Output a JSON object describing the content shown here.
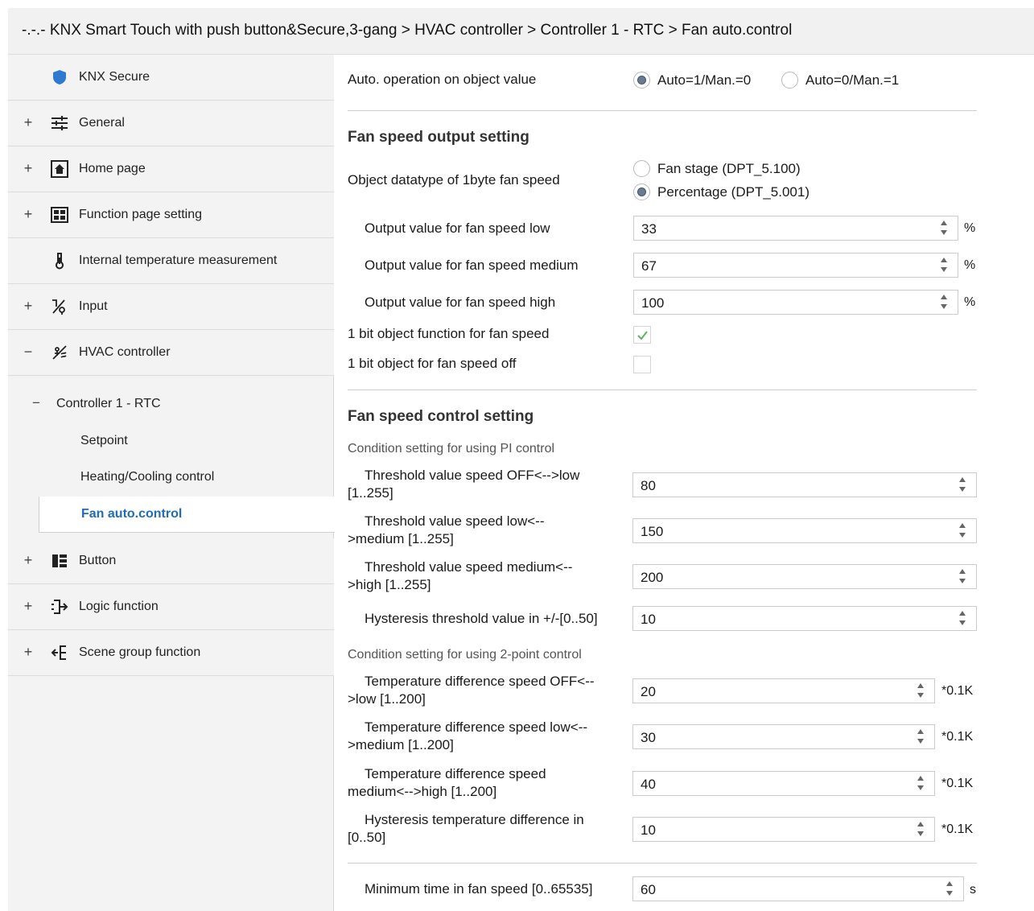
{
  "title": "-.-.- KNX Smart Touch with push button&Secure,3-gang > HVAC controller > Controller 1 - RTC > Fan auto.control",
  "sidebar": {
    "items": [
      {
        "label": "KNX Secure",
        "expander": "",
        "icon": "shield-icon"
      },
      {
        "label": "General",
        "expander": "+",
        "icon": "sliders-icon"
      },
      {
        "label": "Home page",
        "expander": "+",
        "icon": "home-icon"
      },
      {
        "label": "Function page setting",
        "expander": "+",
        "icon": "grid-icon"
      },
      {
        "label": "Internal temperature measurement",
        "expander": "",
        "icon": "thermometer-icon"
      },
      {
        "label": "Input",
        "expander": "+",
        "icon": "input-icon"
      },
      {
        "label": "HVAC controller",
        "expander": "−",
        "icon": "hvac-icon"
      }
    ],
    "controller": {
      "label": "Controller 1 - RTC",
      "expander": "−"
    },
    "sub_items": [
      "Setpoint",
      "Heating/Cooling control",
      "Fan auto.control"
    ],
    "bottom_items": [
      {
        "label": "Button",
        "expander": "+",
        "icon": "button-icon"
      },
      {
        "label": "Logic function",
        "expander": "+",
        "icon": "logic-icon"
      },
      {
        "label": "Scene group function",
        "expander": "+",
        "icon": "scene-icon"
      }
    ]
  },
  "main": {
    "auto_op": {
      "label": "Auto. operation on object value",
      "options": [
        "Auto=1/Man.=0",
        "Auto=0/Man.=1"
      ],
      "selected": 0
    },
    "fan_output": {
      "title": "Fan speed output setting",
      "datatype_label": "Object datatype of 1byte fan speed",
      "datatype_options": [
        "Fan stage (DPT_5.100)",
        "Percentage (DPT_5.001)"
      ],
      "datatype_selected": 1,
      "low": {
        "label": "Output value for fan speed low",
        "value": "33",
        "unit": "%"
      },
      "medium": {
        "label": "Output value for fan speed medium",
        "value": "67",
        "unit": "%"
      },
      "high": {
        "label": "Output value for fan speed high",
        "value": "100",
        "unit": "%"
      },
      "bit_function": {
        "label": "1 bit object function for fan speed",
        "checked": true
      },
      "bit_off": {
        "label": "1 bit object for fan speed off",
        "checked": false
      }
    },
    "fan_control": {
      "title": "Fan speed control setting",
      "pi_title": "Condition setting for using PI control",
      "pi": [
        {
          "label_line1": "Threshold value speed OFF<-->low",
          "label_line2": "[1..255]",
          "value": "80"
        },
        {
          "label_line1": "Threshold value speed low<--",
          "label_line2": ">medium [1..255]",
          "value": "150"
        },
        {
          "label_line1": "Threshold value speed medium<--",
          "label_line2": ">high [1..255]",
          "value": "200"
        }
      ],
      "pi_hyst": {
        "label": "Hysteresis threshold value in +/-[0..50]",
        "value": "10"
      },
      "twopt_title": "Condition setting for using 2-point control",
      "twopt": [
        {
          "label_line1": "Temperature difference speed OFF<--",
          "label_line2": ">low [1..200]",
          "value": "20",
          "unit": "*0.1K"
        },
        {
          "label_line1": "Temperature difference speed low<--",
          "label_line2": ">medium [1..200]",
          "value": "30",
          "unit": "*0.1K"
        },
        {
          "label_line1": "Temperature difference speed",
          "label_line2": "medium<-->high [1..200]",
          "value": "40",
          "unit": "*0.1K"
        },
        {
          "label_line1": "Hysteresis temperature difference in",
          "label_line2": "[0..50]",
          "value": "10",
          "unit": "*0.1K"
        }
      ]
    },
    "min_time": {
      "label": "Minimum time in fan speed [0..65535]",
      "value": "60",
      "unit": "s"
    }
  }
}
